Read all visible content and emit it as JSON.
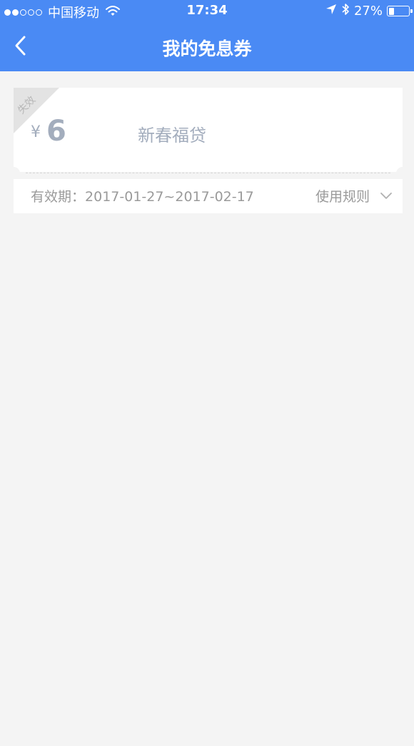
{
  "status_bar": {
    "carrier": "中国移动",
    "time": "17:34",
    "battery": "27%",
    "battery_level": 0.27,
    "icons": [
      "signal-dots-icon",
      "wifi-icon",
      "location-arrow-icon",
      "bluetooth-icon",
      "battery-icon"
    ]
  },
  "nav": {
    "title": "我的免息券",
    "back_icon": "chevron-left-icon"
  },
  "coupon": {
    "status_label": "失效",
    "currency": "¥",
    "amount": "6",
    "name": "新春福贷",
    "validity_label": "有效期：",
    "validity_range": "2017-01-27~2017-02-17",
    "rules_label": "使用规则",
    "rules_icon": "chevron-down-icon"
  },
  "colors": {
    "header_bg": "#4a8af4",
    "page_bg": "#f4f4f4",
    "card_bg": "#ffffff",
    "expired_text": "#a3adbd",
    "muted_text": "#9a9a9a",
    "expired_corner": "#e3e3e3"
  }
}
